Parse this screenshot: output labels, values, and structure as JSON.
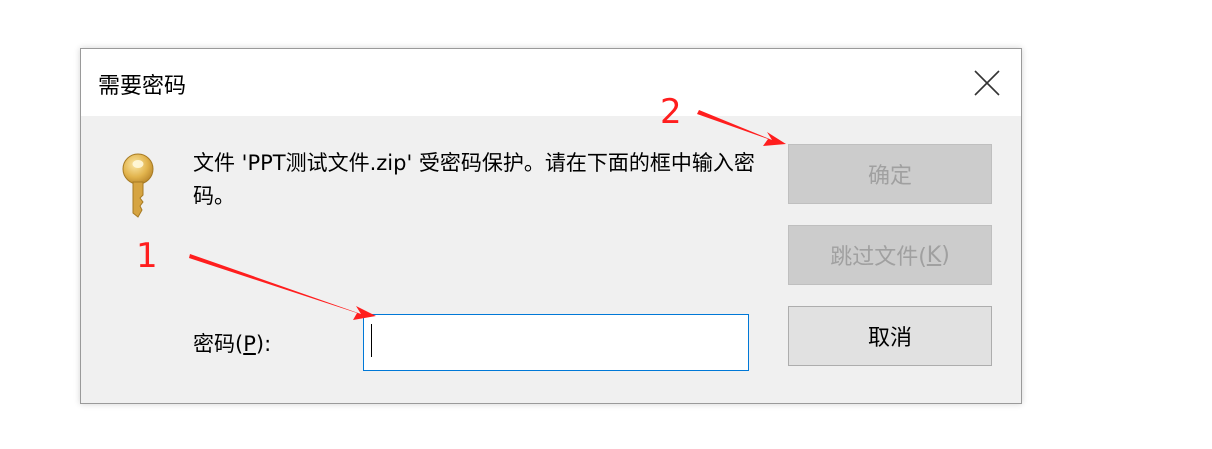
{
  "dialog": {
    "title": "需要密码",
    "message": "文件 'PPT测试文件.zip' 受密码保护。请在下面的框中输入密码。",
    "password_label": "密码(",
    "password_mnemonic": "P",
    "password_label_suffix": "):",
    "password_value": "",
    "buttons": {
      "ok": "确定",
      "skip_prefix": "跳过文件(",
      "skip_mnemonic": "K",
      "skip_suffix": ")",
      "cancel": "取消"
    }
  },
  "annotations": {
    "step1": "1",
    "step2": "2",
    "color": "#ff1e1e"
  },
  "icons": {
    "key": "key-icon",
    "close": "close-icon"
  }
}
